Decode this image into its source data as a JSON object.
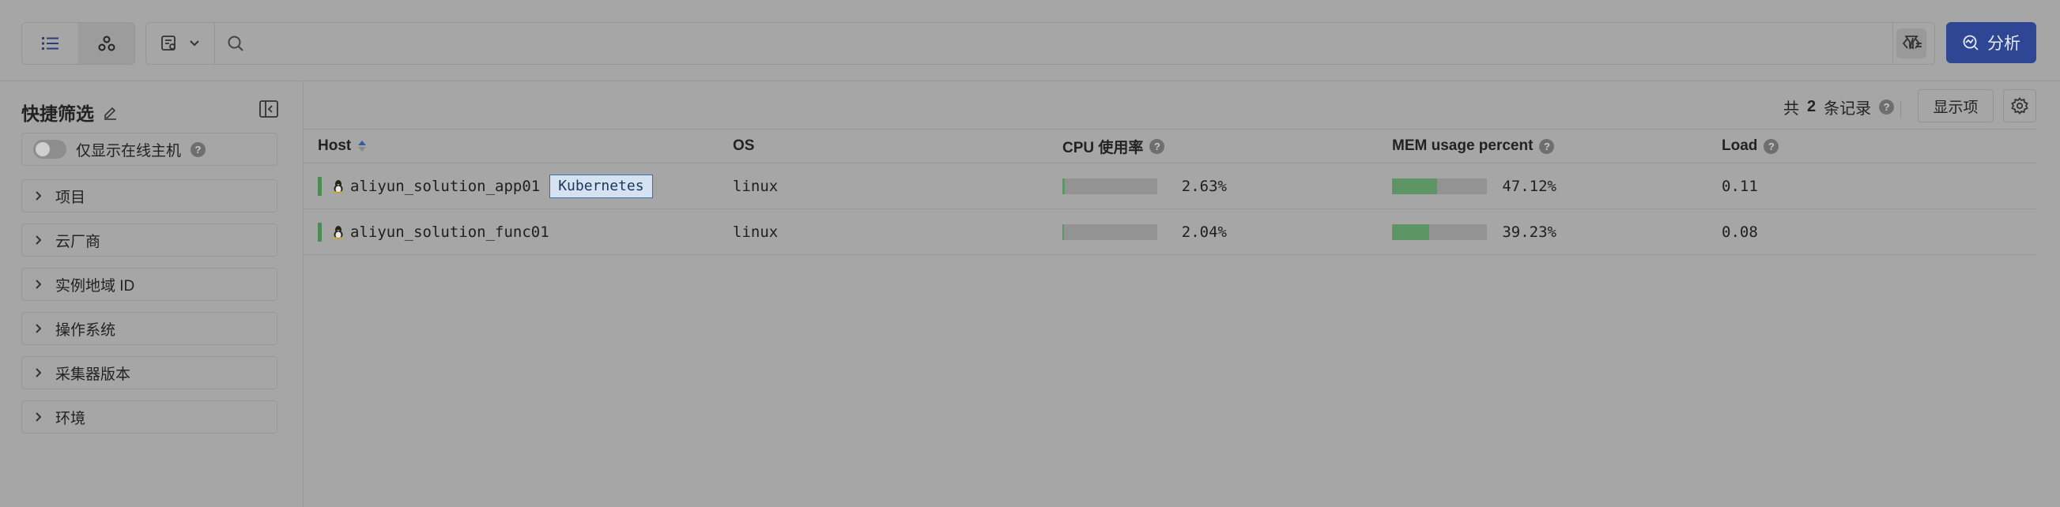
{
  "toolbar": {
    "search": {
      "value": "",
      "placeholder": ""
    },
    "analyze_label": "分析"
  },
  "sidebar": {
    "title": "快捷筛选",
    "online_only_label": "仅显示在线主机",
    "online_only_on": false,
    "facets": [
      {
        "label": "项目"
      },
      {
        "label": "云厂商"
      },
      {
        "label": "实例地域 ID"
      },
      {
        "label": "操作系统"
      },
      {
        "label": "采集器版本"
      },
      {
        "label": "环境"
      }
    ]
  },
  "main": {
    "record_prefix": "共",
    "record_count": "2",
    "record_suffix": "条记录",
    "columns_button": "显示项",
    "table": {
      "headers": {
        "host": "Host",
        "os": "OS",
        "cpu": "CPU 使用率",
        "mem": "MEM usage percent",
        "load": "Load"
      },
      "rows": [
        {
          "host": "aliyun_solution_app01",
          "tag": "Kubernetes",
          "os": "linux",
          "cpu": "2.63%",
          "cpu_value": 2.63,
          "mem": "47.12%",
          "mem_value": 47.12,
          "load": "0.11"
        },
        {
          "host": "aliyun_solution_func01",
          "tag": "",
          "os": "linux",
          "cpu": "2.04%",
          "cpu_value": 2.04,
          "mem": "39.23%",
          "mem_value": 39.23,
          "load": "0.08"
        }
      ]
    }
  },
  "colors": {
    "accent": "#2e4694",
    "status_online": "#4e8a55",
    "bar_fill": "#5e9565",
    "tag_border": "#3a6cb0"
  }
}
